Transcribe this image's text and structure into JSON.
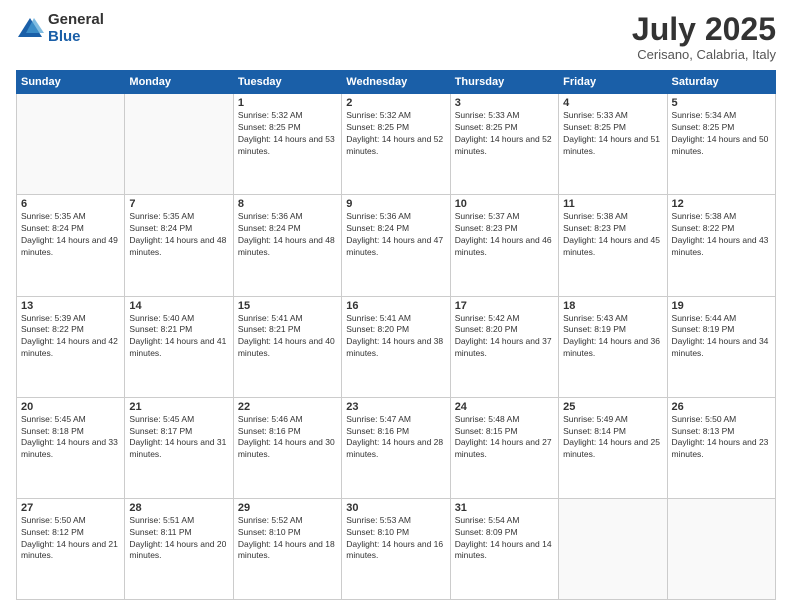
{
  "logo": {
    "general": "General",
    "blue": "Blue"
  },
  "header": {
    "month": "July 2025",
    "location": "Cerisano, Calabria, Italy"
  },
  "weekdays": [
    "Sunday",
    "Monday",
    "Tuesday",
    "Wednesday",
    "Thursday",
    "Friday",
    "Saturday"
  ],
  "weeks": [
    [
      {
        "day": "",
        "info": ""
      },
      {
        "day": "",
        "info": ""
      },
      {
        "day": "1",
        "info": "Sunrise: 5:32 AM\nSunset: 8:25 PM\nDaylight: 14 hours and 53 minutes."
      },
      {
        "day": "2",
        "info": "Sunrise: 5:32 AM\nSunset: 8:25 PM\nDaylight: 14 hours and 52 minutes."
      },
      {
        "day": "3",
        "info": "Sunrise: 5:33 AM\nSunset: 8:25 PM\nDaylight: 14 hours and 52 minutes."
      },
      {
        "day": "4",
        "info": "Sunrise: 5:33 AM\nSunset: 8:25 PM\nDaylight: 14 hours and 51 minutes."
      },
      {
        "day": "5",
        "info": "Sunrise: 5:34 AM\nSunset: 8:25 PM\nDaylight: 14 hours and 50 minutes."
      }
    ],
    [
      {
        "day": "6",
        "info": "Sunrise: 5:35 AM\nSunset: 8:24 PM\nDaylight: 14 hours and 49 minutes."
      },
      {
        "day": "7",
        "info": "Sunrise: 5:35 AM\nSunset: 8:24 PM\nDaylight: 14 hours and 48 minutes."
      },
      {
        "day": "8",
        "info": "Sunrise: 5:36 AM\nSunset: 8:24 PM\nDaylight: 14 hours and 48 minutes."
      },
      {
        "day": "9",
        "info": "Sunrise: 5:36 AM\nSunset: 8:24 PM\nDaylight: 14 hours and 47 minutes."
      },
      {
        "day": "10",
        "info": "Sunrise: 5:37 AM\nSunset: 8:23 PM\nDaylight: 14 hours and 46 minutes."
      },
      {
        "day": "11",
        "info": "Sunrise: 5:38 AM\nSunset: 8:23 PM\nDaylight: 14 hours and 45 minutes."
      },
      {
        "day": "12",
        "info": "Sunrise: 5:38 AM\nSunset: 8:22 PM\nDaylight: 14 hours and 43 minutes."
      }
    ],
    [
      {
        "day": "13",
        "info": "Sunrise: 5:39 AM\nSunset: 8:22 PM\nDaylight: 14 hours and 42 minutes."
      },
      {
        "day": "14",
        "info": "Sunrise: 5:40 AM\nSunset: 8:21 PM\nDaylight: 14 hours and 41 minutes."
      },
      {
        "day": "15",
        "info": "Sunrise: 5:41 AM\nSunset: 8:21 PM\nDaylight: 14 hours and 40 minutes."
      },
      {
        "day": "16",
        "info": "Sunrise: 5:41 AM\nSunset: 8:20 PM\nDaylight: 14 hours and 38 minutes."
      },
      {
        "day": "17",
        "info": "Sunrise: 5:42 AM\nSunset: 8:20 PM\nDaylight: 14 hours and 37 minutes."
      },
      {
        "day": "18",
        "info": "Sunrise: 5:43 AM\nSunset: 8:19 PM\nDaylight: 14 hours and 36 minutes."
      },
      {
        "day": "19",
        "info": "Sunrise: 5:44 AM\nSunset: 8:19 PM\nDaylight: 14 hours and 34 minutes."
      }
    ],
    [
      {
        "day": "20",
        "info": "Sunrise: 5:45 AM\nSunset: 8:18 PM\nDaylight: 14 hours and 33 minutes."
      },
      {
        "day": "21",
        "info": "Sunrise: 5:45 AM\nSunset: 8:17 PM\nDaylight: 14 hours and 31 minutes."
      },
      {
        "day": "22",
        "info": "Sunrise: 5:46 AM\nSunset: 8:16 PM\nDaylight: 14 hours and 30 minutes."
      },
      {
        "day": "23",
        "info": "Sunrise: 5:47 AM\nSunset: 8:16 PM\nDaylight: 14 hours and 28 minutes."
      },
      {
        "day": "24",
        "info": "Sunrise: 5:48 AM\nSunset: 8:15 PM\nDaylight: 14 hours and 27 minutes."
      },
      {
        "day": "25",
        "info": "Sunrise: 5:49 AM\nSunset: 8:14 PM\nDaylight: 14 hours and 25 minutes."
      },
      {
        "day": "26",
        "info": "Sunrise: 5:50 AM\nSunset: 8:13 PM\nDaylight: 14 hours and 23 minutes."
      }
    ],
    [
      {
        "day": "27",
        "info": "Sunrise: 5:50 AM\nSunset: 8:12 PM\nDaylight: 14 hours and 21 minutes."
      },
      {
        "day": "28",
        "info": "Sunrise: 5:51 AM\nSunset: 8:11 PM\nDaylight: 14 hours and 20 minutes."
      },
      {
        "day": "29",
        "info": "Sunrise: 5:52 AM\nSunset: 8:10 PM\nDaylight: 14 hours and 18 minutes."
      },
      {
        "day": "30",
        "info": "Sunrise: 5:53 AM\nSunset: 8:10 PM\nDaylight: 14 hours and 16 minutes."
      },
      {
        "day": "31",
        "info": "Sunrise: 5:54 AM\nSunset: 8:09 PM\nDaylight: 14 hours and 14 minutes."
      },
      {
        "day": "",
        "info": ""
      },
      {
        "day": "",
        "info": ""
      }
    ]
  ]
}
